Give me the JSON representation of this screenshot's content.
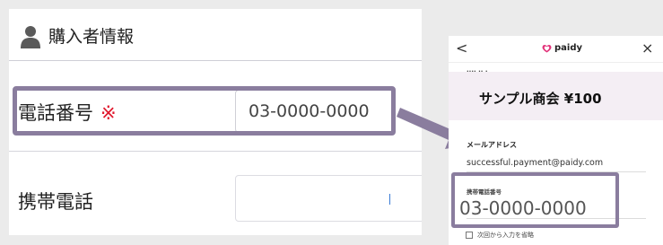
{
  "form": {
    "section_title": "購入者情報",
    "tel_label": "電話番号",
    "required_mark": "※",
    "tel_value": "03-0000-0000",
    "mobile_label": "携帯電話",
    "mobile_value": ""
  },
  "checkout": {
    "back_label": "<",
    "close_label": "×",
    "brand": "paidy",
    "merchant_summary": "サンプル商会 ¥100",
    "email_label": "メールアドレス",
    "email_value": "successful.payment@paidy.com",
    "phone_label": "携帯電話番号",
    "phone_value": "03-0000-0000",
    "remember_label": "次回から入力を省略"
  },
  "colors": {
    "highlight": "#8a7d9e",
    "required": "#e0182d",
    "paidy_pink": "#e2337a",
    "merchant_bg": "#f4eef4"
  },
  "icons": [
    "person-icon",
    "chevron-left-icon",
    "close-icon",
    "paidy-heart-icon",
    "arrow-right-icon",
    "checkbox-icon"
  ]
}
